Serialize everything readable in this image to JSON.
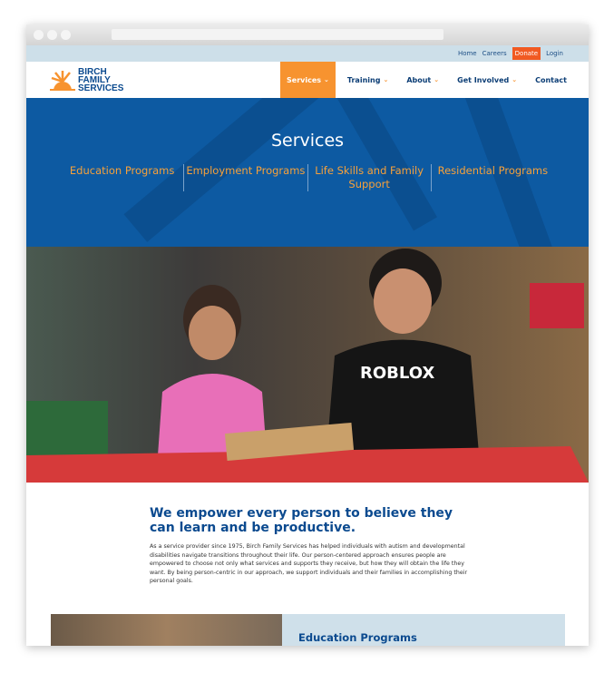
{
  "utility_nav": [
    "Home",
    "Careers",
    "Donate",
    "Login"
  ],
  "logo": {
    "lines": [
      "BIRCH",
      "FAMILY",
      "SERVICES"
    ]
  },
  "main_nav": [
    {
      "label": "Services",
      "dropdown": true,
      "active": true
    },
    {
      "label": "Training",
      "dropdown": true
    },
    {
      "label": "About",
      "dropdown": true
    },
    {
      "label": "Get Involved",
      "dropdown": true
    },
    {
      "label": "Contact",
      "dropdown": false
    }
  ],
  "hero": {
    "title": "Services",
    "tabs": [
      "Education Programs",
      "Employment Programs",
      "Life Skills and Family Support",
      "Residential Programs"
    ]
  },
  "intro": {
    "heading": "We empower every person to believe they can learn and be productive.",
    "body": "As a service provider since 1975, Birch Family Services has helped individuals with autism and developmental disabilities navigate transitions throughout their life. Our person-centered approach ensures people are empowered to choose not only what services and supports they receive, but how they will obtain the life they want. By being person-centric in our approach, we support individuals and their families in accomplishing their personal goals."
  },
  "section": {
    "title": "Education Programs"
  },
  "colors": {
    "brand_blue": "#0d5aa2",
    "accent_orange": "#f7932f",
    "donate": "#f15a22"
  }
}
